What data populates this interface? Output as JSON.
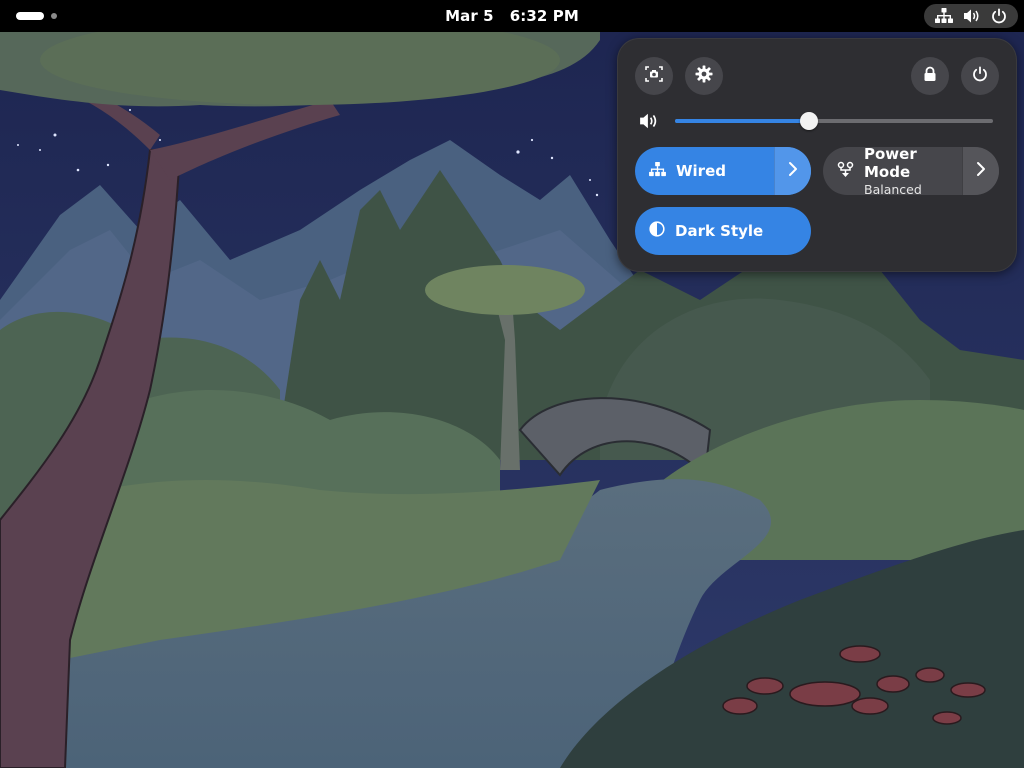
{
  "topbar": {
    "date": "Mar 5",
    "time": "6:32 PM",
    "indicators": [
      {
        "icon": "network-wired-icon"
      },
      {
        "icon": "volume-icon"
      },
      {
        "icon": "power-icon"
      }
    ]
  },
  "quick_settings": {
    "buttons": {
      "screenshot": "screenshot-icon",
      "settings": "gear-icon",
      "lock": "lock-icon",
      "power": "power-icon"
    },
    "volume": {
      "icon": "volume-icon",
      "level": 0.42
    },
    "toggles": {
      "wired": {
        "label": "Wired",
        "active": true,
        "icon": "network-wired-icon"
      },
      "power_mode": {
        "label": "Power Mode",
        "sublabel": "Balanced",
        "active": false,
        "icon": "power-profile-icon"
      },
      "dark_style": {
        "label": "Dark Style",
        "active": true,
        "icon": "dark-style-icon"
      }
    }
  },
  "colors": {
    "accent": "#3584e4",
    "panel": "#2e2e32",
    "button": "#46464b"
  }
}
